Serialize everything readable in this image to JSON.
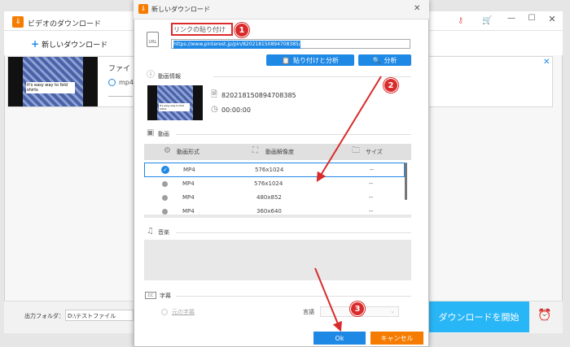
{
  "bg_app": {
    "title": "ビデオのダウンロード",
    "new_download_label": "新しいダウンロード",
    "card_title_prefix": "ファイ",
    "card_format": "mp4",
    "thumbnail_caption": "It's easy way to fold shirts",
    "output_folder_label": "出力フォルダ：",
    "output_folder_value": "D:\\テストファイル",
    "start_download_label": "ダウンロードを開始"
  },
  "dialog": {
    "title": "新しいダウンロード",
    "link_label": "リンクの貼り付け",
    "url_value": "https://www.pinterest.jp/pin/820218150894708385/",
    "paste_analyze_label": "貼り付けと分析",
    "analyze_label": "分析",
    "video_info_label": "動画情報",
    "video_id": "820218150894708385",
    "duration": "00:00:00",
    "video_section_label": "動画",
    "columns": [
      "動画形式",
      "動画解像度",
      "サイズ"
    ],
    "rows": [
      {
        "format": "MP4",
        "resolution": "576x1024",
        "size": "--"
      },
      {
        "format": "MP4",
        "resolution": "576x1024",
        "size": "--"
      },
      {
        "format": "MP4",
        "resolution": "480x852",
        "size": "--"
      },
      {
        "format": "MP4",
        "resolution": "360x640",
        "size": "--"
      }
    ],
    "audio_section_label": "音楽",
    "subtitle_section_label": "字幕",
    "original_subtitle_label": "元の字幕",
    "language_label": "言語",
    "ok_label": "Ok",
    "cancel_label": "キャンセル"
  },
  "annotations": [
    "1",
    "2",
    "3"
  ],
  "colors": {
    "accent": "#1e88e5",
    "cancel": "#f57c00",
    "annotation": "#d92b2b",
    "start_button": "#29b6f6"
  }
}
